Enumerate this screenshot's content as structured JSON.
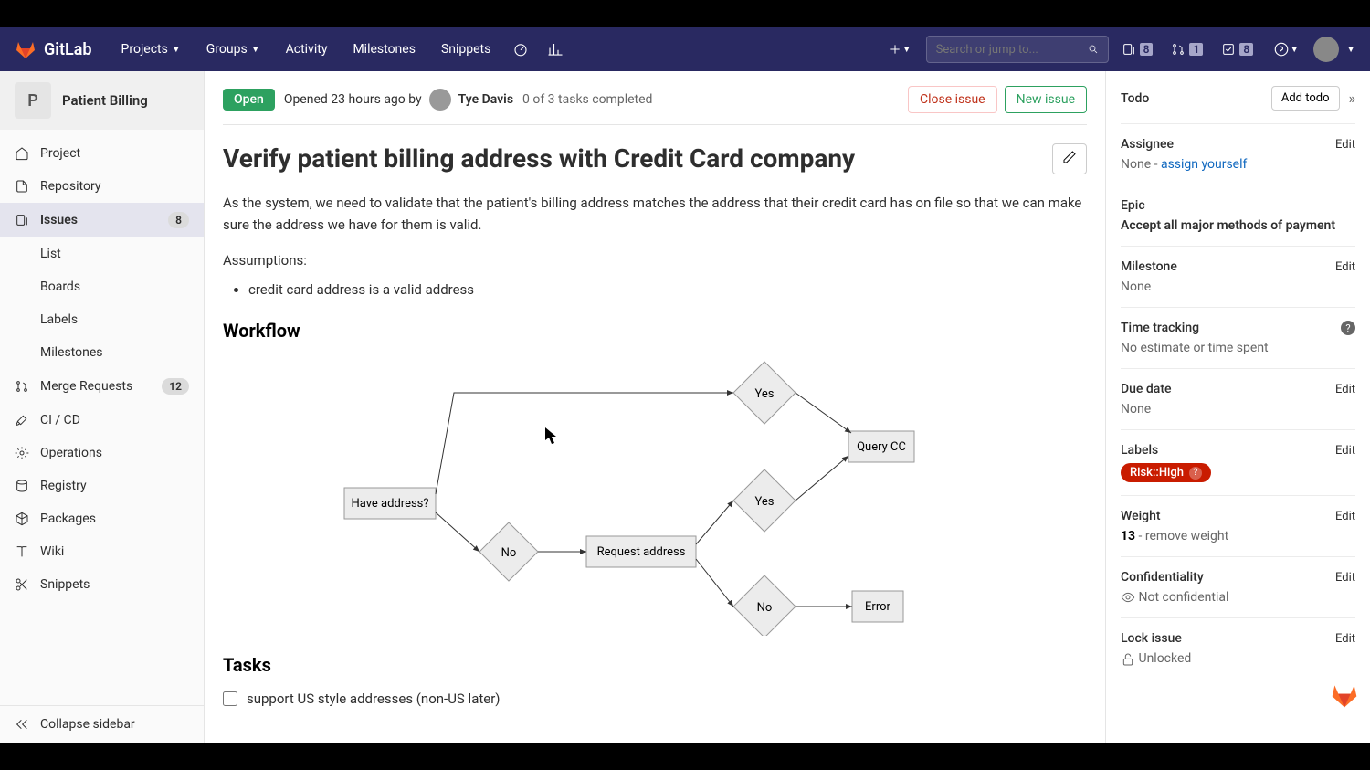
{
  "brand": "GitLab",
  "topnav": {
    "items": [
      "Projects",
      "Groups",
      "Activity",
      "Milestones",
      "Snippets"
    ],
    "search_placeholder": "Search or jump to...",
    "counters": {
      "issues": "8",
      "mrs": "1",
      "todos": "8"
    }
  },
  "project": {
    "initial": "P",
    "name": "Patient Billing"
  },
  "sidebar": {
    "project": "Project",
    "repository": "Repository",
    "issues": "Issues",
    "issues_badge": "8",
    "list": "List",
    "boards": "Boards",
    "labels": "Labels",
    "milestones": "Milestones",
    "merge_requests": "Merge Requests",
    "mr_badge": "12",
    "cicd": "CI / CD",
    "operations": "Operations",
    "registry": "Registry",
    "packages": "Packages",
    "wiki": "Wiki",
    "snippets": "Snippets",
    "collapse": "Collapse sidebar"
  },
  "issue": {
    "status": "Open",
    "opened_text": "Opened 23 hours ago by",
    "author": "Tye Davis",
    "tasks_count": "0 of 3 tasks completed",
    "close_btn": "Close issue",
    "new_btn": "New issue",
    "title": "Verify patient billing address with Credit Card company",
    "description": "As the system, we need to validate that the patient's billing address matches the address that their credit card has on file so that we can make sure the address we have for them is valid.",
    "assumptions_heading": "Assumptions:",
    "assumptions": [
      "credit card address is a valid address"
    ],
    "workflow_heading": "Workflow",
    "workflow": {
      "have_address": "Have address?",
      "yes1": "Yes",
      "yes2": "Yes",
      "no1": "No",
      "no2": "No",
      "request": "Request address",
      "query": "Query CC",
      "error": "Error"
    },
    "tasks_heading": "Tasks",
    "tasks": [
      "support US style addresses (non-US later)"
    ]
  },
  "rightbar": {
    "todo_label": "Todo",
    "add_todo": "Add todo",
    "assignee_label": "Assignee",
    "assignee_value": "None - ",
    "assignee_link": "assign yourself",
    "epic_label": "Epic",
    "epic_value": "Accept all major methods of payment",
    "milestone_label": "Milestone",
    "milestone_value": "None",
    "time_label": "Time tracking",
    "time_value": "No estimate or time spent",
    "due_label": "Due date",
    "due_value": "None",
    "labels_label": "Labels",
    "label_pill": "Risk::High",
    "weight_label": "Weight",
    "weight_value": "13",
    "weight_remove": " - remove weight",
    "conf_label": "Confidentiality",
    "conf_value": "Not confidential",
    "lock_label": "Lock issue",
    "lock_value": "Unlocked",
    "edit": "Edit"
  }
}
